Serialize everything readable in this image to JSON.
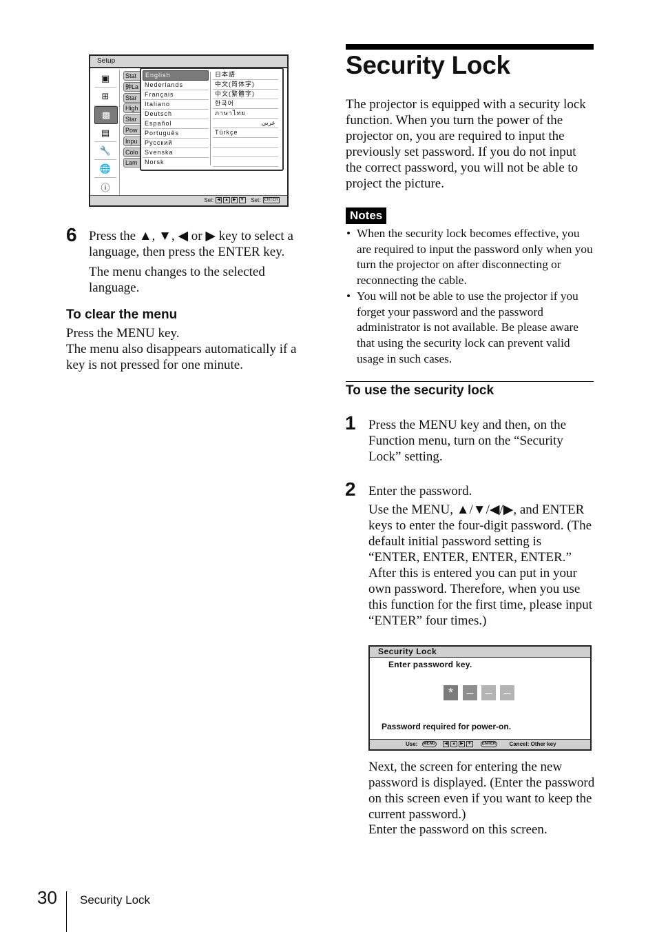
{
  "setup_menu": {
    "title": "Setup",
    "sidebar_icons": [
      "picture-icon",
      "screen-icon",
      "toolbox-icon",
      "function-icon",
      "wrench-icon",
      "globe-icon",
      "info-icon"
    ],
    "selected_icon_index": 2,
    "items": [
      "Stat",
      "鈡La",
      "Star",
      "High",
      "Star",
      "Pow",
      "Inpu",
      "Colo",
      "Lam"
    ],
    "languages_col1": [
      "English",
      "Nederlands",
      "Français",
      "Italiano",
      "Deutsch",
      "Español",
      "Português",
      "Русский",
      "Svenska",
      "Norsk"
    ],
    "languages_col2": [
      "日本語",
      "中文(简体字)",
      "中文(繁體字)",
      "한국어",
      "ภาษาไทย",
      "عربي",
      "Türkçe",
      "",
      "",
      ""
    ],
    "selected_language": "English",
    "footer_sel": "Sel:",
    "footer_set": "Set:",
    "enter_key": "ENTER"
  },
  "left_column": {
    "step6_number": "6",
    "step6_text": "Press the ▲, ▼, ◀ or ▶ key to select a language, then press the ENTER key.",
    "step6_note": "The menu changes to the selected language.",
    "clear_heading": "To clear the menu",
    "clear_line1": "Press the MENU key.",
    "clear_line2": "The menu also disappears automatically if a key is not pressed for one minute."
  },
  "right_column": {
    "page_title": "Security Lock",
    "intro": "The projector is equipped with a security lock function. When you turn the power of the projector on, you are required to input the previously set password. If you do not input the correct password, you will not be able to project the picture.",
    "notes_label": "Notes",
    "notes": [
      "When the security lock becomes effective, you are required to input the password only when you turn the projector on after disconnecting or reconnecting the cable.",
      "You will not be able to use the projector if you forget your password and the password administrator is not available. Be please aware that using the security lock can prevent valid usage in such cases."
    ],
    "use_heading": "To use the security lock",
    "step1_number": "1",
    "step1_text": "Press the MENU key and then, on the Function menu, turn on the “Security Lock” setting.",
    "step2_number": "2",
    "step2_text": "Enter the password.",
    "step2_detail": "Use the MENU, ▲/▼/◀/▶, and ENTER keys to enter the four-digit password. (The default initial password setting is “ENTER, ENTER, ENTER, ENTER.” After this is entered you can put in your own password. Therefore, when you use this function for the first time, please input “ENTER” four times.)",
    "after_screen": "Next, the screen for entering the new password is displayed. (Enter the password on this screen even if you want to keep the current password.)",
    "after_screen2": "Enter the password on this screen."
  },
  "lock_screen": {
    "title": "Security Lock",
    "prompt": "Enter password key.",
    "password_slots": [
      "*",
      "–",
      "–",
      "–"
    ],
    "slot_colors": [
      "#7c7c7c",
      "#8e8e8e",
      "#b4b4b4",
      "#b4b4b4"
    ],
    "status": "Password required for power-on.",
    "footer_use": "Use:",
    "menu_key": "MENU",
    "enter_key": "ENTER",
    "footer_cancel": "Cancel: Other key"
  },
  "footer": {
    "page_number": "30",
    "section": "Security Lock"
  }
}
